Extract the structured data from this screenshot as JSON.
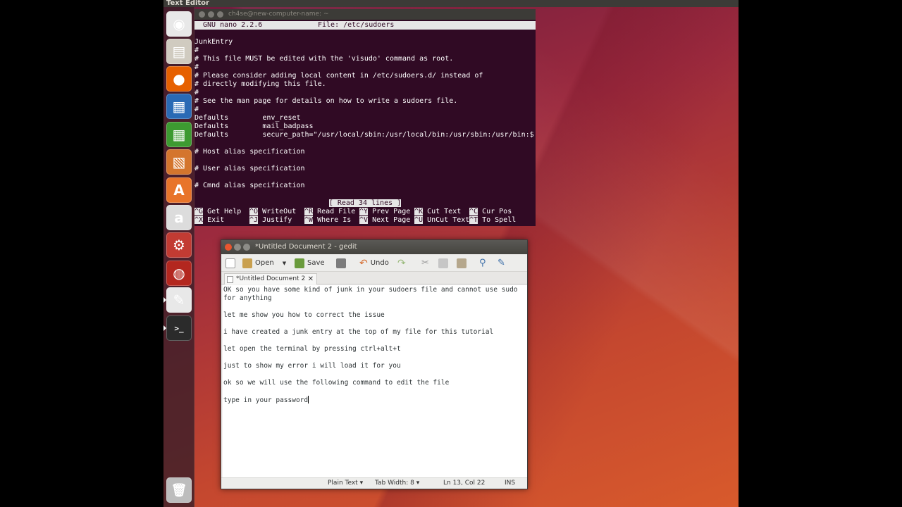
{
  "top_panel": {
    "title": "Text Editor"
  },
  "launcher": {
    "items": [
      {
        "name": "dash-icon",
        "glyph": "◉",
        "color": "#e8e8e8"
      },
      {
        "name": "files-icon",
        "glyph": "▤",
        "color": "#d0cbc0"
      },
      {
        "name": "firefox-icon",
        "glyph": "●",
        "color": "#e66000"
      },
      {
        "name": "writer-icon",
        "glyph": "▦",
        "color": "#2a6ab5"
      },
      {
        "name": "calc-icon",
        "glyph": "▦",
        "color": "#3d9a31"
      },
      {
        "name": "impress-icon",
        "glyph": "▧",
        "color": "#d4752d"
      },
      {
        "name": "software-center-icon",
        "glyph": "A",
        "color": "#e8742a"
      },
      {
        "name": "amazon-icon",
        "glyph": "a",
        "color": "#dcdcdc"
      },
      {
        "name": "settings-icon",
        "glyph": "⚙",
        "color": "#c23b33"
      },
      {
        "name": "ubuntu-one-icon",
        "glyph": "◍",
        "color": "#b3271f"
      },
      {
        "name": "text-editor-icon",
        "glyph": "✎",
        "color": "#e8e8e8"
      },
      {
        "name": "terminal-icon",
        "glyph": ">_",
        "color": "#2b2b2b"
      }
    ],
    "trash": {
      "name": "trash-icon",
      "glyph": "🗑",
      "color": "#bdbdbd"
    }
  },
  "terminal": {
    "title": "ch4se@new-computer-name: ~",
    "nano_version": "GNU nano 2.2.6",
    "nano_file": "File: /etc/sudoers",
    "lines": [
      "",
      "JunkEntry",
      "#",
      "# This file MUST be edited with the 'visudo' command as root.",
      "#",
      "# Please consider adding local content in /etc/sudoers.d/ instead of",
      "# directly modifying this file.",
      "#",
      "# See the man page for details on how to write a sudoers file.",
      "#",
      "Defaults        env_reset",
      "Defaults        mail_badpass",
      "Defaults        secure_path=\"/usr/local/sbin:/usr/local/bin:/usr/sbin:/usr/bin:$",
      "",
      "# Host alias specification",
      "",
      "# User alias specification",
      "",
      "# Cmnd alias specification",
      ""
    ],
    "status": "[ Read 34 lines ]",
    "shortcuts_row1": [
      {
        "key": "^G",
        "label": "Get Help"
      },
      {
        "key": "^O",
        "label": "WriteOut"
      },
      {
        "key": "^R",
        "label": "Read File"
      },
      {
        "key": "^Y",
        "label": "Prev Page"
      },
      {
        "key": "^K",
        "label": "Cut Text"
      },
      {
        "key": "^C",
        "label": "Cur Pos"
      }
    ],
    "shortcuts_row2": [
      {
        "key": "^X",
        "label": "Exit"
      },
      {
        "key": "^J",
        "label": "Justify"
      },
      {
        "key": "^W",
        "label": "Where Is"
      },
      {
        "key": "^V",
        "label": "Next Page"
      },
      {
        "key": "^U",
        "label": "UnCut Text"
      },
      {
        "key": "^T",
        "label": "To Spell"
      }
    ]
  },
  "gedit": {
    "title": "*Untitled Document 2 - gedit",
    "toolbar": {
      "open": "Open",
      "save": "Save",
      "undo": "Undo"
    },
    "tab": "*Untitled Document 2",
    "lines": [
      "OK so you have some kind of junk in your sudoers file and cannot use sudo for anything",
      "",
      "let me show you how to correct the issue",
      "",
      "i have created a junk entry at the top of my file for this tutorial",
      "",
      "let open the terminal by pressing ctrl+alt+t",
      "",
      "just to show my error i will load it for you",
      "",
      "ok so we will use the following command to edit the file",
      "",
      "type in your password"
    ],
    "status": {
      "language": "Plain Text ▾",
      "tab_width": "Tab Width: 8 ▾",
      "position": "Ln 13, Col 22",
      "mode": "INS"
    }
  }
}
